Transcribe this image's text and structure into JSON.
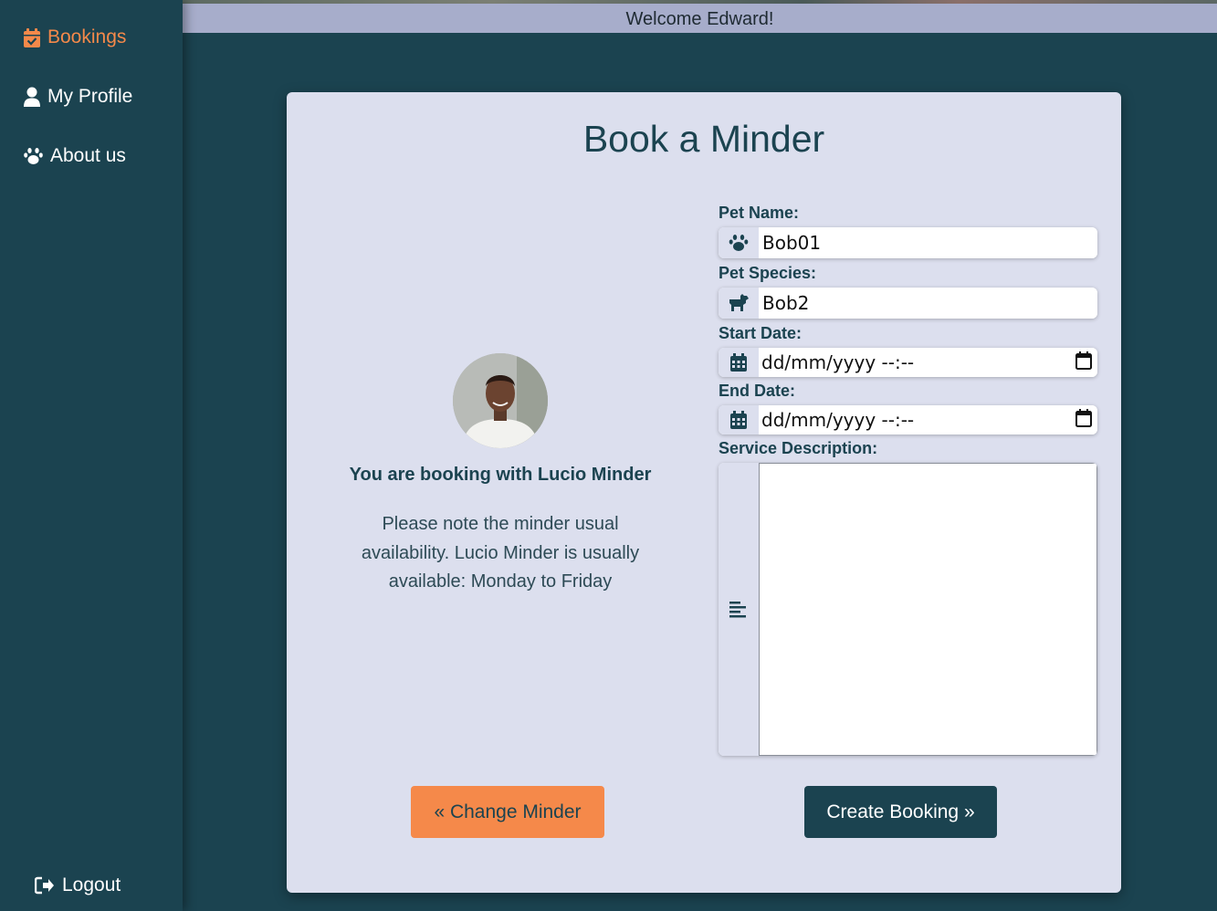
{
  "sidebar": {
    "items": [
      {
        "label": "Bookings",
        "icon": "calendar-check-icon",
        "active": true
      },
      {
        "label": "My Profile",
        "icon": "user-icon",
        "active": false
      },
      {
        "label": "About us",
        "icon": "paw-icon",
        "active": false
      }
    ],
    "logout": {
      "label": "Logout",
      "icon": "sign-out-icon"
    }
  },
  "header": {
    "welcome": "Welcome Edward!"
  },
  "card": {
    "title": "Book a Minder",
    "minder": {
      "booking_text": "You are booking with Lucio Minder",
      "availability_note": "Please note the minder usual availability. Lucio Minder is usually available: Monday to Friday",
      "avatar": "minder-avatar-photo"
    },
    "form": {
      "pet_name": {
        "label": "Pet Name:",
        "value": "Bob01",
        "icon": "paw-icon"
      },
      "pet_species": {
        "label": "Pet Species:",
        "value": "Bob2",
        "icon": "dog-icon"
      },
      "start_date": {
        "label": "Start Date:",
        "placeholder": "dd/mm/yyyy --:--",
        "icon": "calendar-icon"
      },
      "end_date": {
        "label": "End Date:",
        "placeholder": "dd/mm/yyyy --:--",
        "icon": "calendar-icon"
      },
      "service_description": {
        "label": "Service Description:",
        "value": "",
        "icon": "align-left-icon"
      }
    },
    "buttons": {
      "change_minder": "« Change Minder",
      "create_booking": "Create Booking »"
    }
  },
  "colors": {
    "sidebar_bg": "#1b4350",
    "accent_orange": "#f5894a",
    "card_bg": "#dcdfee",
    "topbar_bg": "#a7adcb",
    "primary_dark": "#1b4350"
  }
}
